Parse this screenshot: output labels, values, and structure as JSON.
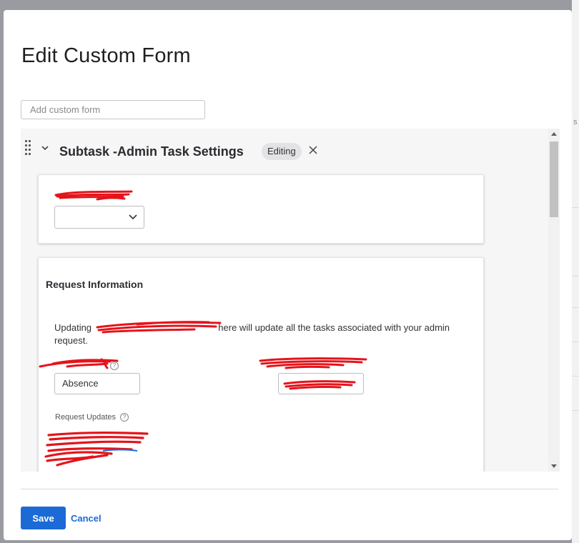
{
  "background": {
    "edge_text": "s"
  },
  "modal": {
    "title": "Edit Custom Form",
    "add_form_placeholder": "Add custom form",
    "section": {
      "title": "Subtask -Admin Task Settings",
      "status_badge": "Editing"
    },
    "request_card": {
      "heading": "Request Information",
      "description_prefix": "Updating",
      "description_suffix": "here will update all the tasks associated with your admin request.",
      "field1_value": "Absence",
      "updates_label": "Request Updates"
    },
    "footer": {
      "save_label": "Save",
      "cancel_label": "Cancel"
    }
  },
  "colors": {
    "primary": "#1b6ad6",
    "redaction": "#e4141b",
    "overlay": "#9a9ba0"
  },
  "icons": [
    "drag-handle-icon",
    "chevron-down-icon",
    "close-icon",
    "help-icon",
    "scroll-up-icon",
    "scroll-down-icon"
  ]
}
